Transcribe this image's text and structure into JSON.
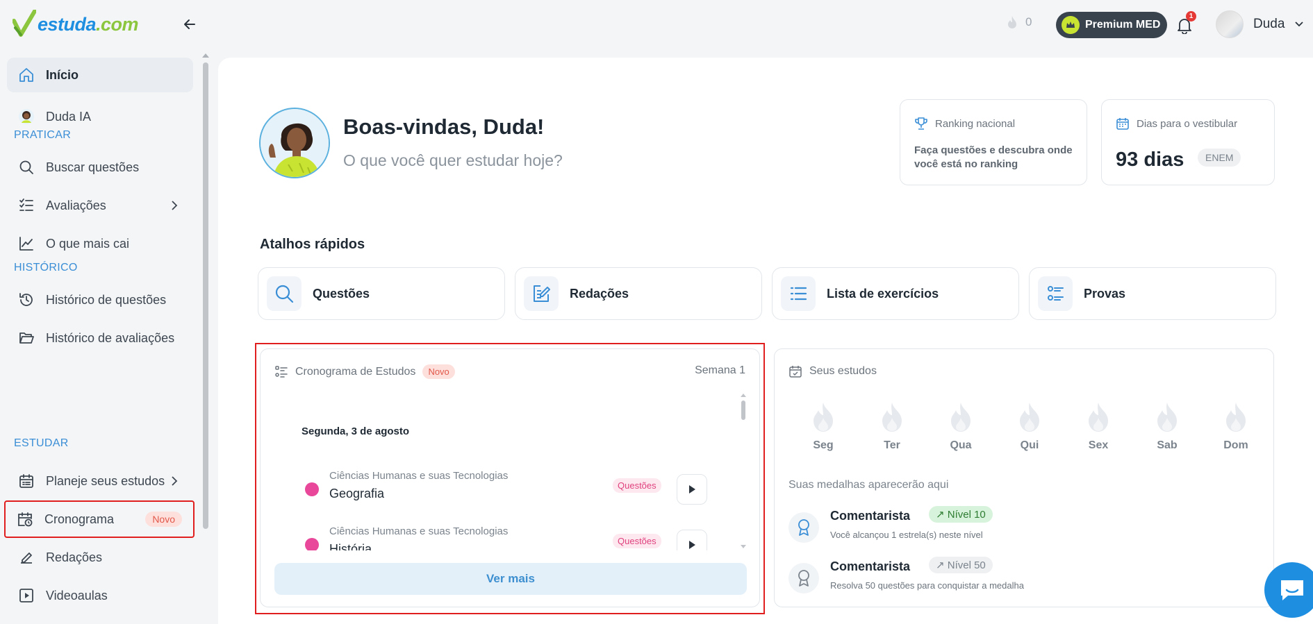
{
  "brand": {
    "name_main": "estuda",
    "name_suffix": ".com"
  },
  "topbar": {
    "streak_count": "0",
    "premium_label": "Premium MED",
    "notification_count": "1",
    "user_name": "Duda"
  },
  "sidebar": {
    "items": [
      {
        "label": "Início"
      },
      {
        "label": "Duda IA"
      },
      {
        "label": "Buscar questões"
      },
      {
        "label": "Avaliações"
      },
      {
        "label": "O que mais cai"
      },
      {
        "label": "Histórico de questões"
      },
      {
        "label": "Histórico de avaliações"
      },
      {
        "label": "Planeje seus estudos"
      },
      {
        "label": "Cronograma",
        "tag": "Novo"
      },
      {
        "label": "Redações"
      },
      {
        "label": "Videoaulas"
      }
    ],
    "sections": {
      "praticar": "PRATICAR",
      "historico": "HISTÓRICO",
      "estudar": "ESTUDAR"
    }
  },
  "welcome": {
    "title": "Boas-vindas, Duda!",
    "subtitle": "O que você quer estudar hoje?"
  },
  "ranking": {
    "title": "Ranking nacional",
    "body": "Faça questões e descubra onde você está no ranking"
  },
  "countdown": {
    "title": "Dias para o vestibular",
    "value": "93 dias",
    "exam": "ENEM"
  },
  "shortcuts": {
    "title": "Atalhos rápidos",
    "items": [
      {
        "label": "Questões"
      },
      {
        "label": "Redações"
      },
      {
        "label": "Lista de exercícios"
      },
      {
        "label": "Provas"
      }
    ]
  },
  "cronograma": {
    "title": "Cronograma de Estudos",
    "tag": "Novo",
    "week": "Semana 1",
    "day": "Segunda, 3 de agosto",
    "subjects": [
      {
        "area": "Ciências Humanas e suas Tecnologias",
        "name": "Geografia",
        "type": "Questões"
      },
      {
        "area": "Ciências Humanas e suas Tecnologias",
        "name": "História",
        "type": "Questões"
      }
    ],
    "more": "Ver mais"
  },
  "estudos": {
    "title": "Seus estudos",
    "days": [
      "Seg",
      "Ter",
      "Qua",
      "Qui",
      "Sex",
      "Sab",
      "Dom"
    ],
    "medals_title": "Suas medalhas aparecerão aqui",
    "medals": [
      {
        "title": "Comentarista",
        "level": "Nível 10",
        "desc": "Você alcançou 1 estrela(s) neste nível"
      },
      {
        "title": "Comentarista",
        "level": "Nível 50",
        "desc": "Resolva 50 questões para conquistar a medalha"
      }
    ]
  },
  "colors": {
    "accent": "#1e8ee0",
    "brand_green": "#8cc63f",
    "highlight": "#e01e1e",
    "subject_dot": "#e8479a"
  }
}
